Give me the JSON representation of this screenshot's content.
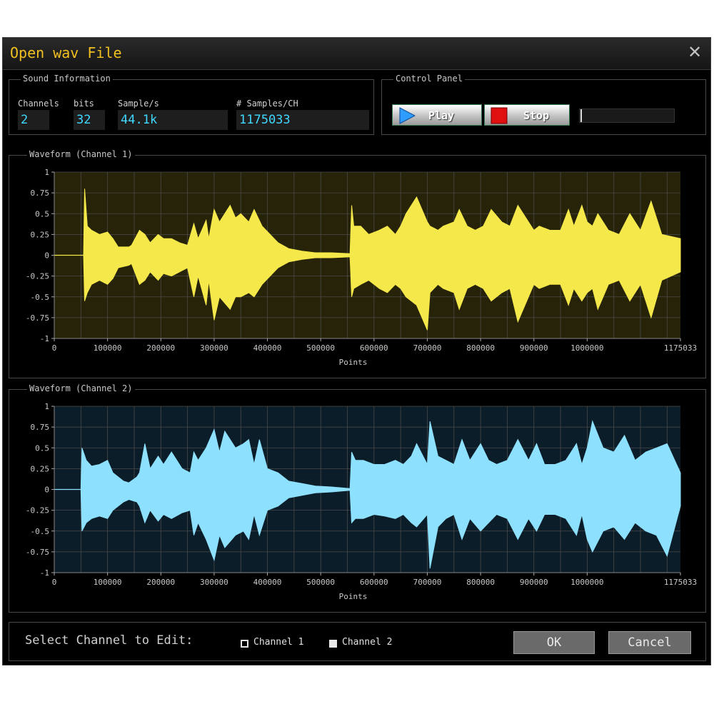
{
  "window": {
    "title": "Open wav File"
  },
  "sound_info": {
    "legend": "Sound Information",
    "channels_label": "Channels",
    "channels_value": "2",
    "bits_label": "bits",
    "bits_value": "32",
    "sample_label": "Sample/s",
    "sample_value": "44.1k",
    "samples_label": "# Samples/CH",
    "samples_value": "1175033"
  },
  "control_panel": {
    "legend": "Control Panel",
    "play_label": "Play",
    "stop_label": "Stop",
    "play_color": "#2f9cff",
    "stop_color": "#e01010"
  },
  "chart_data": [
    {
      "type": "area",
      "title": "Waveform (Channel 1)",
      "xlabel": "Points",
      "ylabel": "",
      "xlim": [
        0,
        1175033
      ],
      "ylim": [
        -1,
        1
      ],
      "x_ticks": [
        "0",
        "100000",
        "200000",
        "300000",
        "400000",
        "500000",
        "600000",
        "700000",
        "800000",
        "900000",
        "1000000",
        "1175033"
      ],
      "y_ticks": [
        "1",
        "0.75",
        "0.5",
        "0.25",
        "0",
        "-0.25",
        "-0.5",
        "-0.75",
        "-1"
      ],
      "grid": true,
      "color": "#f5e84a",
      "background": "#272308",
      "series": [
        {
          "x": [
            0,
            55000,
            57000,
            62000,
            70000,
            85000,
            100000,
            110000,
            120000,
            140000,
            145000,
            160000,
            170000,
            180000,
            195000,
            205000,
            220000,
            235000,
            250000,
            262000,
            270000,
            285000,
            290000,
            300000,
            310000,
            330000,
            340000,
            350000,
            365000,
            375000,
            390000,
            405000,
            420000,
            440000,
            465000,
            490000,
            520000,
            555000,
            558000,
            562000,
            575000,
            590000,
            610000,
            625000,
            640000,
            650000,
            660000,
            680000,
            700000,
            705000,
            720000,
            730000,
            750000,
            760000,
            775000,
            790000,
            805000,
            820000,
            840000,
            855000,
            870000,
            900000,
            910000,
            930000,
            950000,
            965000,
            975000,
            990000,
            1000000,
            1010000,
            1020000,
            1040000,
            1060000,
            1080000,
            1100000,
            1120000,
            1140000,
            1175033
          ],
          "upper": [
            0,
            0,
            0.8,
            0.35,
            0.3,
            0.25,
            0.28,
            0.2,
            0.1,
            0.1,
            0.12,
            0.3,
            0.25,
            0.15,
            0.25,
            0.2,
            0.2,
            0.15,
            0.12,
            0.38,
            0.2,
            0.42,
            0.2,
            0.55,
            0.4,
            0.6,
            0.45,
            0.5,
            0.4,
            0.55,
            0.35,
            0.25,
            0.15,
            0.08,
            0.05,
            0.03,
            0.03,
            0.02,
            0.6,
            0.35,
            0.35,
            0.25,
            0.3,
            0.35,
            0.25,
            0.35,
            0.5,
            0.7,
            0.4,
            0.35,
            0.3,
            0.35,
            0.4,
            0.55,
            0.35,
            0.3,
            0.35,
            0.55,
            0.4,
            0.35,
            0.6,
            0.3,
            0.35,
            0.3,
            0.3,
            0.55,
            0.35,
            0.6,
            0.4,
            0.35,
            0.5,
            0.3,
            0.25,
            0.5,
            0.3,
            0.65,
            0.25,
            0.2
          ],
          "lower": [
            0,
            0,
            -0.55,
            -0.45,
            -0.35,
            -0.3,
            -0.35,
            -0.28,
            -0.15,
            -0.12,
            -0.1,
            -0.35,
            -0.3,
            -0.2,
            -0.3,
            -0.22,
            -0.25,
            -0.2,
            -0.15,
            -0.5,
            -0.25,
            -0.6,
            -0.3,
            -0.78,
            -0.5,
            -0.65,
            -0.5,
            -0.5,
            -0.45,
            -0.5,
            -0.35,
            -0.25,
            -0.15,
            -0.08,
            -0.05,
            -0.03,
            -0.03,
            -0.02,
            -0.5,
            -0.4,
            -0.35,
            -0.3,
            -0.4,
            -0.45,
            -0.35,
            -0.4,
            -0.5,
            -0.6,
            -0.9,
            -0.45,
            -0.35,
            -0.4,
            -0.45,
            -0.65,
            -0.4,
            -0.35,
            -0.4,
            -0.55,
            -0.45,
            -0.4,
            -0.8,
            -0.35,
            -0.4,
            -0.35,
            -0.35,
            -0.6,
            -0.4,
            -0.55,
            -0.45,
            -0.4,
            -0.65,
            -0.35,
            -0.3,
            -0.55,
            -0.35,
            -0.75,
            -0.3,
            -0.2
          ]
        }
      ]
    },
    {
      "type": "area",
      "title": "Waveform (Channel 2)",
      "xlabel": "Points",
      "ylabel": "",
      "xlim": [
        0,
        1175033
      ],
      "ylim": [
        -1,
        1
      ],
      "x_ticks": [
        "0",
        "100000",
        "200000",
        "300000",
        "400000",
        "500000",
        "600000",
        "700000",
        "800000",
        "900000",
        "1000000",
        "1175033"
      ],
      "y_ticks": [
        "1",
        "0.75",
        "0.5",
        "0.25",
        "0",
        "-0.25",
        "-0.5",
        "-0.75",
        "-1"
      ],
      "grid": true,
      "color": "#8ee0ff",
      "background": "#0b1d28",
      "series": [
        {
          "x": [
            0,
            50000,
            52000,
            60000,
            70000,
            85000,
            100000,
            110000,
            130000,
            140000,
            155000,
            160000,
            170000,
            180000,
            195000,
            205000,
            220000,
            240000,
            255000,
            262000,
            270000,
            285000,
            300000,
            310000,
            320000,
            340000,
            355000,
            365000,
            375000,
            385000,
            400000,
            420000,
            440000,
            465000,
            490000,
            520000,
            555000,
            558000,
            565000,
            580000,
            600000,
            620000,
            640000,
            655000,
            670000,
            680000,
            700000,
            705000,
            720000,
            735000,
            750000,
            765000,
            780000,
            800000,
            815000,
            830000,
            850000,
            870000,
            890000,
            905000,
            920000,
            940000,
            960000,
            980000,
            990000,
            1000000,
            1010000,
            1030000,
            1050000,
            1070000,
            1090000,
            1110000,
            1130000,
            1150000,
            1175033
          ],
          "upper": [
            0,
            0,
            0.5,
            0.35,
            0.28,
            0.3,
            0.35,
            0.2,
            0.1,
            0.08,
            0.15,
            0.2,
            0.55,
            0.25,
            0.4,
            0.3,
            0.45,
            0.25,
            0.2,
            0.45,
            0.35,
            0.5,
            0.72,
            0.45,
            0.7,
            0.5,
            0.55,
            0.6,
            0.3,
            0.6,
            0.25,
            0.2,
            0.1,
            0.07,
            0.04,
            0.03,
            0.01,
            0.45,
            0.35,
            0.35,
            0.3,
            0.3,
            0.35,
            0.3,
            0.4,
            0.55,
            0.3,
            0.82,
            0.4,
            0.35,
            0.3,
            0.6,
            0.35,
            0.55,
            0.35,
            0.3,
            0.35,
            0.6,
            0.35,
            0.55,
            0.3,
            0.3,
            0.35,
            0.55,
            0.3,
            0.5,
            0.82,
            0.5,
            0.45,
            0.65,
            0.35,
            0.45,
            0.5,
            0.55,
            0.2
          ],
          "lower": [
            0,
            0,
            -0.5,
            -0.4,
            -0.35,
            -0.32,
            -0.35,
            -0.25,
            -0.15,
            -0.12,
            -0.15,
            -0.2,
            -0.4,
            -0.25,
            -0.38,
            -0.3,
            -0.35,
            -0.28,
            -0.25,
            -0.55,
            -0.4,
            -0.6,
            -0.85,
            -0.55,
            -0.7,
            -0.55,
            -0.5,
            -0.6,
            -0.3,
            -0.55,
            -0.25,
            -0.2,
            -0.1,
            -0.07,
            -0.04,
            -0.03,
            -0.01,
            -0.4,
            -0.35,
            -0.35,
            -0.3,
            -0.32,
            -0.35,
            -0.3,
            -0.4,
            -0.45,
            -0.3,
            -0.95,
            -0.45,
            -0.35,
            -0.3,
            -0.6,
            -0.35,
            -0.5,
            -0.4,
            -0.3,
            -0.35,
            -0.6,
            -0.35,
            -0.5,
            -0.3,
            -0.3,
            -0.35,
            -0.55,
            -0.3,
            -0.6,
            -0.75,
            -0.5,
            -0.45,
            -0.6,
            -0.4,
            -0.5,
            -0.55,
            -0.8,
            -0.2
          ]
        }
      ]
    }
  ],
  "footer": {
    "select_label": "Select Channel to Edit:",
    "channel1_label": "Channel 1",
    "channel1_checked": false,
    "channel2_label": "Channel 2",
    "channel2_checked": true,
    "ok_label": "OK",
    "cancel_label": "Cancel"
  }
}
